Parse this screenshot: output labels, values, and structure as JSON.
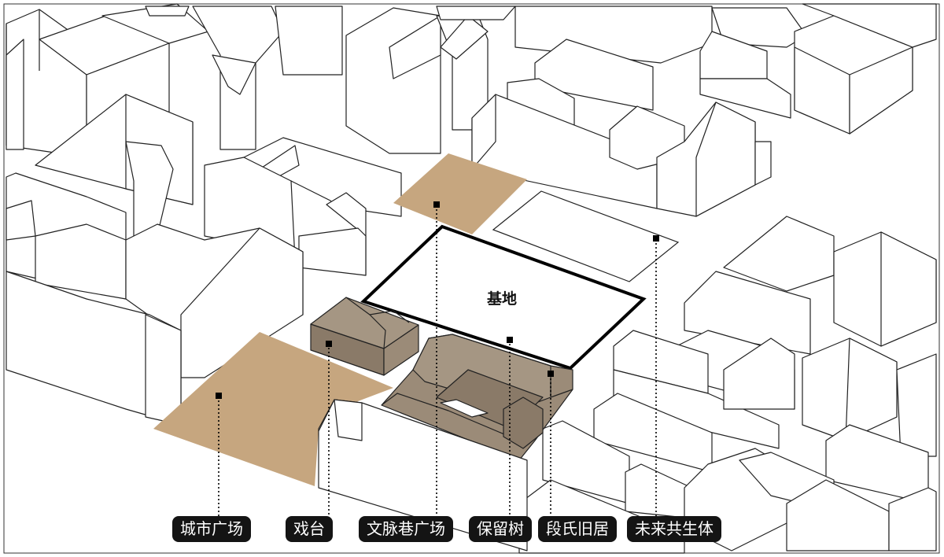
{
  "site": {
    "label": "基地"
  },
  "labels": [
    {
      "id": "city-plaza",
      "text": "城市广场"
    },
    {
      "id": "opera-stage",
      "text": "戏台"
    },
    {
      "id": "alley-plaza",
      "text": "文脉巷广场"
    },
    {
      "id": "preserved-tree",
      "text": "保留树"
    },
    {
      "id": "duan-residence",
      "text": "段氏旧居"
    },
    {
      "id": "future-community",
      "text": "未来共生体"
    }
  ],
  "colors": {
    "plaza": "#c6a67f",
    "heritage": "#9b8b78",
    "heritage_dark": "#8a7a68",
    "building": "#ffffff",
    "outline": "#222222",
    "label_bg": "#141414",
    "label_text": "#ffffff"
  }
}
